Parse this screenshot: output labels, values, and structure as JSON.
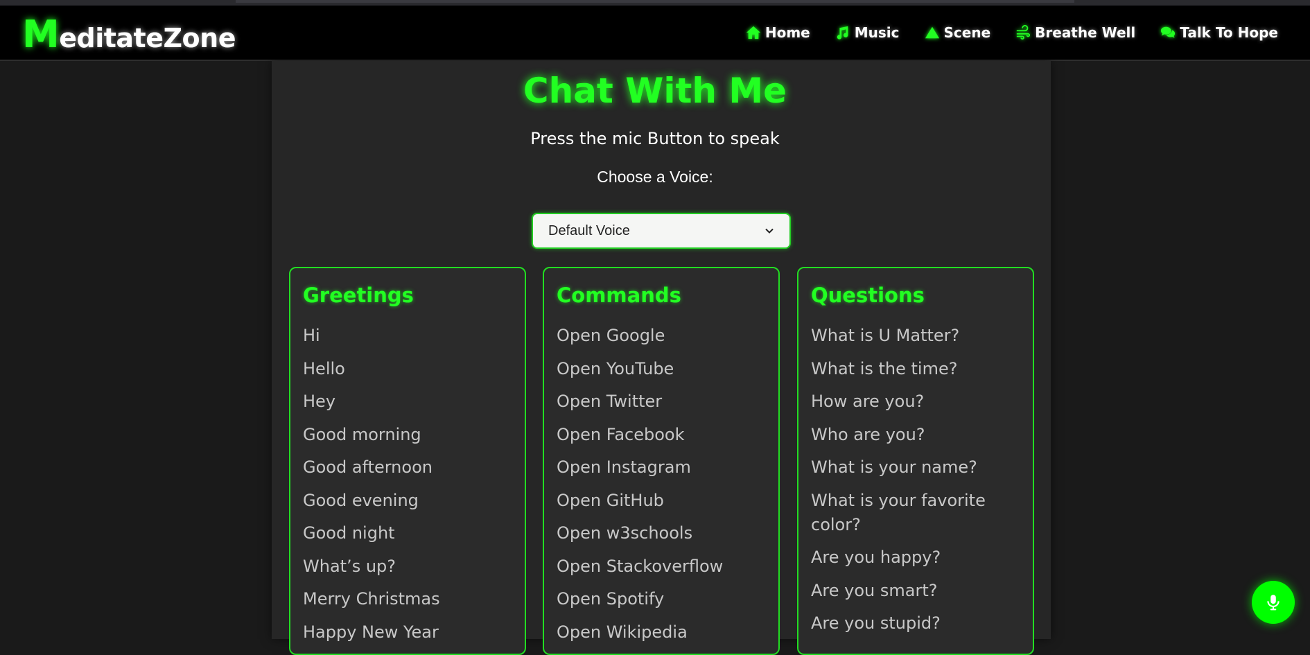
{
  "header": {
    "logo_initial": "M",
    "logo_rest": "editateZone",
    "nav": [
      {
        "label": "Home",
        "icon": "home-icon"
      },
      {
        "label": "Music",
        "icon": "music-note-icon"
      },
      {
        "label": "Scene",
        "icon": "triangle-icon"
      },
      {
        "label": "Breathe Well",
        "icon": "wind-icon"
      },
      {
        "label": "Talk To Hope",
        "icon": "chat-bubbles-icon"
      }
    ]
  },
  "main": {
    "title": "Chat With Me",
    "subtitle": "Press the mic Button to speak",
    "voice_label": "Choose a Voice:",
    "voice_selected": "Default Voice"
  },
  "cards": [
    {
      "title": "Greetings",
      "items": [
        "Hi",
        "Hello",
        "Hey",
        "Good morning",
        "Good afternoon",
        "Good evening",
        "Good night",
        "What’s up?",
        "Merry Christmas",
        "Happy New Year"
      ]
    },
    {
      "title": "Commands",
      "items": [
        "Open Google",
        "Open YouTube",
        "Open Twitter",
        "Open Facebook",
        "Open Instagram",
        "Open GitHub",
        "Open w3schools",
        "Open Stackoverflow",
        "Open Spotify",
        "Open Wikipedia"
      ]
    },
    {
      "title": "Questions",
      "items": [
        "What is U Matter?",
        "What is the time?",
        "How are you?",
        "Who are you?",
        "What is your name?",
        "What is your favorite color?",
        "Are you happy?",
        "Are you smart?",
        "Are you stupid?"
      ]
    }
  ],
  "mic_button": {
    "icon": "microphone-icon"
  },
  "colors": {
    "accent": "#22ff22",
    "background": "#1a1a1a",
    "panel": "#262626",
    "card": "#2b2b2b"
  }
}
